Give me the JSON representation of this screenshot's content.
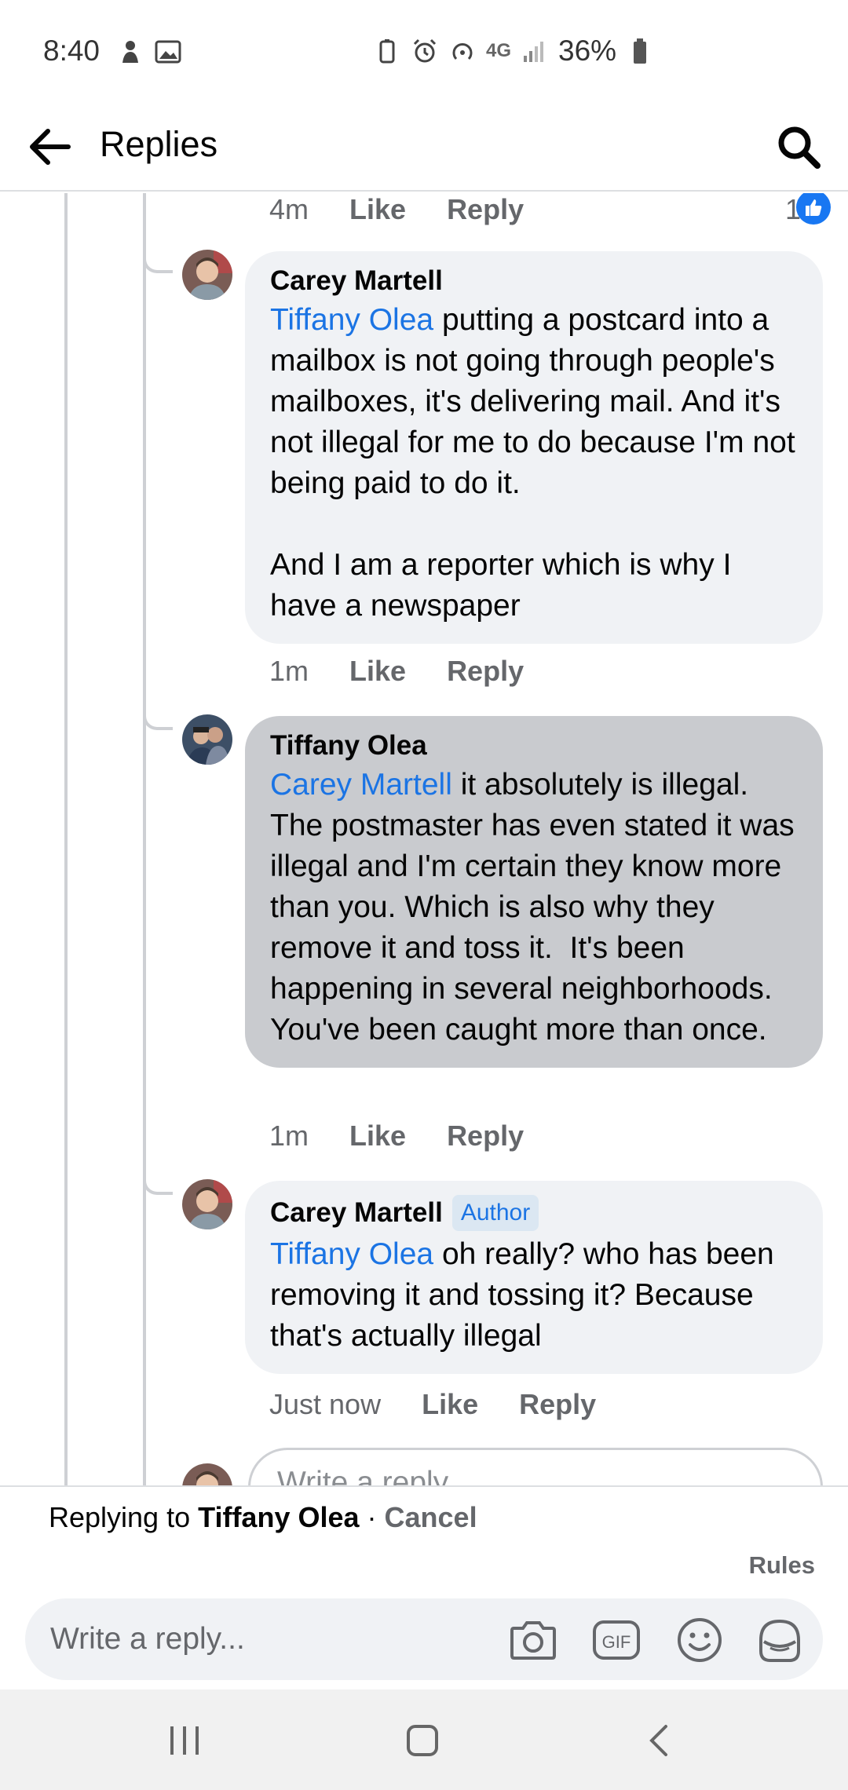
{
  "status_bar": {
    "time": "8:40",
    "battery_pct": "36%",
    "network": "4G"
  },
  "header": {
    "title": "Replies"
  },
  "previous_comment_meta": {
    "time": "4m",
    "like": "Like",
    "reply": "Reply",
    "like_count": "1"
  },
  "comments": [
    {
      "author": "Carey Martell",
      "mention": "Tiffany Olea",
      "text": " putting a postcard into a mailbox is not going through people's mailboxes, it's delivering mail. And it's not illegal for me to do because I'm not being paid to do it.\n\nAnd I am a reporter which is why I have a newspaper",
      "time": "1m",
      "like": "Like",
      "reply": "Reply"
    },
    {
      "author": "Tiffany Olea",
      "mention": "Carey Martell",
      "text": " it absolutely is illegal.  The postmaster has even stated it was illegal and I'm certain they know more than you. Which is also why they remove it and toss it.  It's been happening in several neighborhoods.  You've been caught more than once.",
      "time": "1m",
      "like": "Like",
      "reply": "Reply"
    },
    {
      "author": "Carey Martell",
      "badge": "Author",
      "mention": "Tiffany Olea",
      "text": " oh really? who has been removing it and tossing it? Because that's actually illegal",
      "time": "Just now",
      "like": "Like",
      "reply": "Reply"
    }
  ],
  "inline_write_placeholder": "Write a reply...",
  "composer": {
    "replying_prefix": "Replying to ",
    "replying_to": "Tiffany Olea",
    "separator": " · ",
    "cancel": "Cancel",
    "rules": "Rules",
    "placeholder": "Write a reply...",
    "gif_label": "GIF"
  },
  "colors": {
    "link": "#1b74e4",
    "secondary_text": "#65676b",
    "bubble": "#f0f2f5",
    "bubble_selected": "#c9cbcf",
    "like_badge": "#1877f2"
  },
  "icons": {
    "back": "arrow-left-icon",
    "search": "search-icon",
    "camera": "camera-icon",
    "gif": "gif-icon",
    "emoji": "smiley-icon",
    "sticker": "sticker-icon",
    "like": "thumbs-up-icon"
  }
}
